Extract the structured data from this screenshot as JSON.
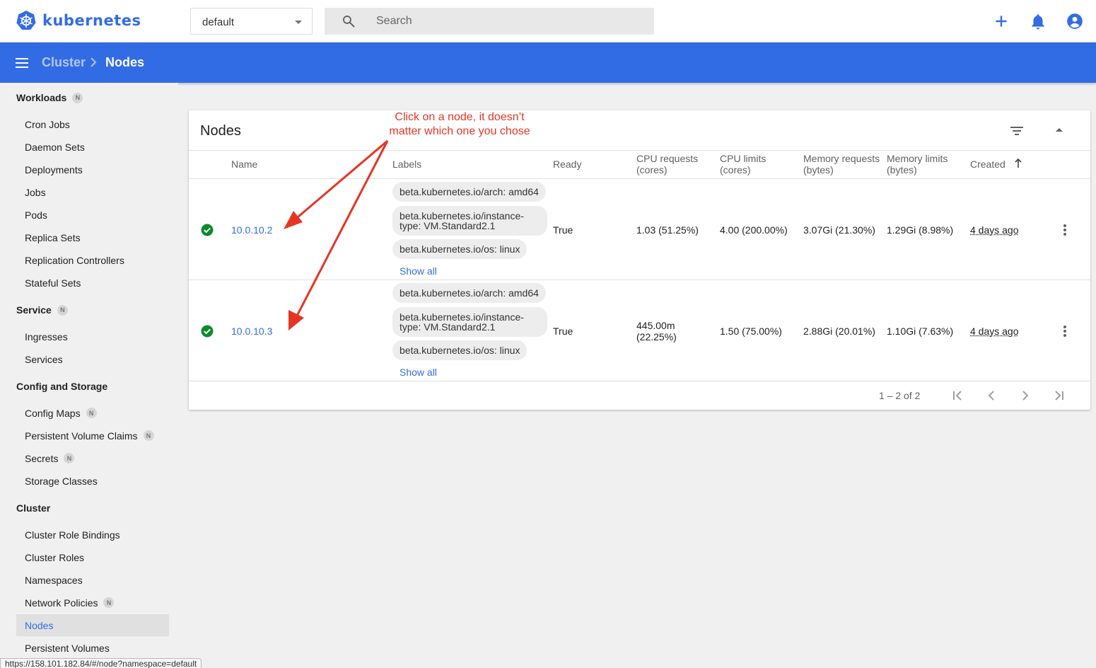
{
  "app": {
    "logo_text": "kubernetes",
    "brand_color": "#326ce5"
  },
  "header": {
    "namespace": "default",
    "search_placeholder": "Search",
    "icons": [
      "add-icon",
      "notifications-icon",
      "account-icon"
    ]
  },
  "toolbar": {
    "crumb_parent": "Cluster",
    "crumb_current": "Nodes"
  },
  "sidebar": {
    "workloads": {
      "label": "Workloads",
      "badge": "N"
    },
    "workload_items": [
      "Cron Jobs",
      "Daemon Sets",
      "Deployments",
      "Jobs",
      "Pods",
      "Replica Sets",
      "Replication Controllers",
      "Stateful Sets"
    ],
    "service": {
      "label": "Service",
      "badge": "N"
    },
    "service_items": [
      "Ingresses",
      "Services"
    ],
    "config": {
      "label": "Config and Storage"
    },
    "config_items": [
      {
        "label": "Config Maps",
        "badge": "N"
      },
      {
        "label": "Persistent Volume Claims",
        "badge": "N"
      },
      {
        "label": "Secrets",
        "badge": "N"
      },
      {
        "label": "Storage Classes"
      }
    ],
    "cluster": {
      "label": "Cluster"
    },
    "cluster_items": [
      {
        "label": "Cluster Role Bindings"
      },
      {
        "label": "Cluster Roles"
      },
      {
        "label": "Namespaces"
      },
      {
        "label": "Network Policies",
        "badge": "N"
      },
      {
        "label": "Nodes",
        "active": true
      },
      {
        "label": "Persistent Volumes"
      }
    ]
  },
  "card": {
    "title": "Nodes",
    "columns": {
      "name": "Name",
      "labels": "Labels",
      "ready": "Ready",
      "cpu_requests": "CPU requests (cores)",
      "cpu_limits": "CPU limits (cores)",
      "mem_requests": "Memory requests (bytes)",
      "mem_limits": "Memory limits (bytes)",
      "created": "Created"
    },
    "rows": [
      {
        "name": "10.0.10.2",
        "status": "ok",
        "labels": [
          "beta.kubernetes.io/arch: amd64",
          "beta.kubernetes.io/instance-type: VM.Standard2.1",
          "beta.kubernetes.io/os: linux"
        ],
        "show_all": "Show all",
        "ready": "True",
        "cpu_requests": "1.03 (51.25%)",
        "cpu_limits": "4.00 (200.00%)",
        "mem_requests": "3.07Gi (21.30%)",
        "mem_limits": "1.29Gi (8.98%)",
        "created": "4 days ago"
      },
      {
        "name": "10.0.10.3",
        "status": "ok",
        "labels": [
          "beta.kubernetes.io/arch: amd64",
          "beta.kubernetes.io/instance-type: VM.Standard2.1",
          "beta.kubernetes.io/os: linux"
        ],
        "show_all": "Show all",
        "ready": "True",
        "cpu_requests": "445.00m (22.25%)",
        "cpu_limits": "1.50 (75.00%)",
        "mem_requests": "2.88Gi (20.01%)",
        "mem_limits": "1.10Gi (7.63%)",
        "created": "4 days ago"
      }
    ],
    "pagination": "1 – 2 of 2"
  },
  "annotation": {
    "text": "Click on a node, it doesn’t matter which one you chose",
    "color": "#e53525"
  },
  "status_bar": {
    "url": "https://158.101.182.84/#/node?namespace=default"
  }
}
